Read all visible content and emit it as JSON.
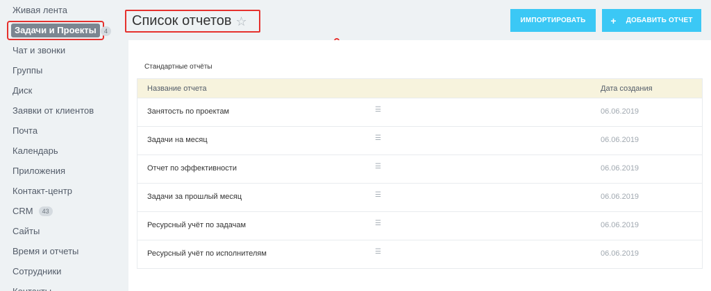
{
  "sidebar": {
    "items": [
      {
        "label": "Живая лента"
      },
      {
        "label": "Задачи и Проекты",
        "counter": "4"
      },
      {
        "label": "Чат и звонки"
      },
      {
        "label": "Группы"
      },
      {
        "label": "Диск"
      },
      {
        "label": "Заявки от клиентов"
      },
      {
        "label": "Почта"
      },
      {
        "label": "Календарь"
      },
      {
        "label": "Приложения"
      },
      {
        "label": "Контакт-центр"
      },
      {
        "label": "CRM",
        "counter": "43"
      },
      {
        "label": "Сайты"
      },
      {
        "label": "Время и отчеты"
      },
      {
        "label": "Сотрудники"
      },
      {
        "label": "Контакты"
      }
    ]
  },
  "header": {
    "title": "Список отчетов",
    "star_icon": "star-outline-icon",
    "import_label": "Импортировать",
    "add_label": "Добавить отчет",
    "accent_color": "#3bc8f5",
    "highlight_color": "#e5312d"
  },
  "main": {
    "section_title": "Стандартные отчёты",
    "columns": [
      "Название отчета",
      "Дата создания"
    ],
    "rows": [
      {
        "name": "Занятость по проектам",
        "date": "06.06.2019"
      },
      {
        "name": "Задачи на месяц",
        "date": "06.06.2019"
      },
      {
        "name": "Отчет по эффективности",
        "date": "06.06.2019"
      },
      {
        "name": "Задачи за прошлый месяц",
        "date": "06.06.2019"
      },
      {
        "name": "Ресурсный учёт по задачам",
        "date": "06.06.2019"
      },
      {
        "name": "Ресурсный учёт по исполнителям",
        "date": "06.06.2019"
      }
    ]
  }
}
